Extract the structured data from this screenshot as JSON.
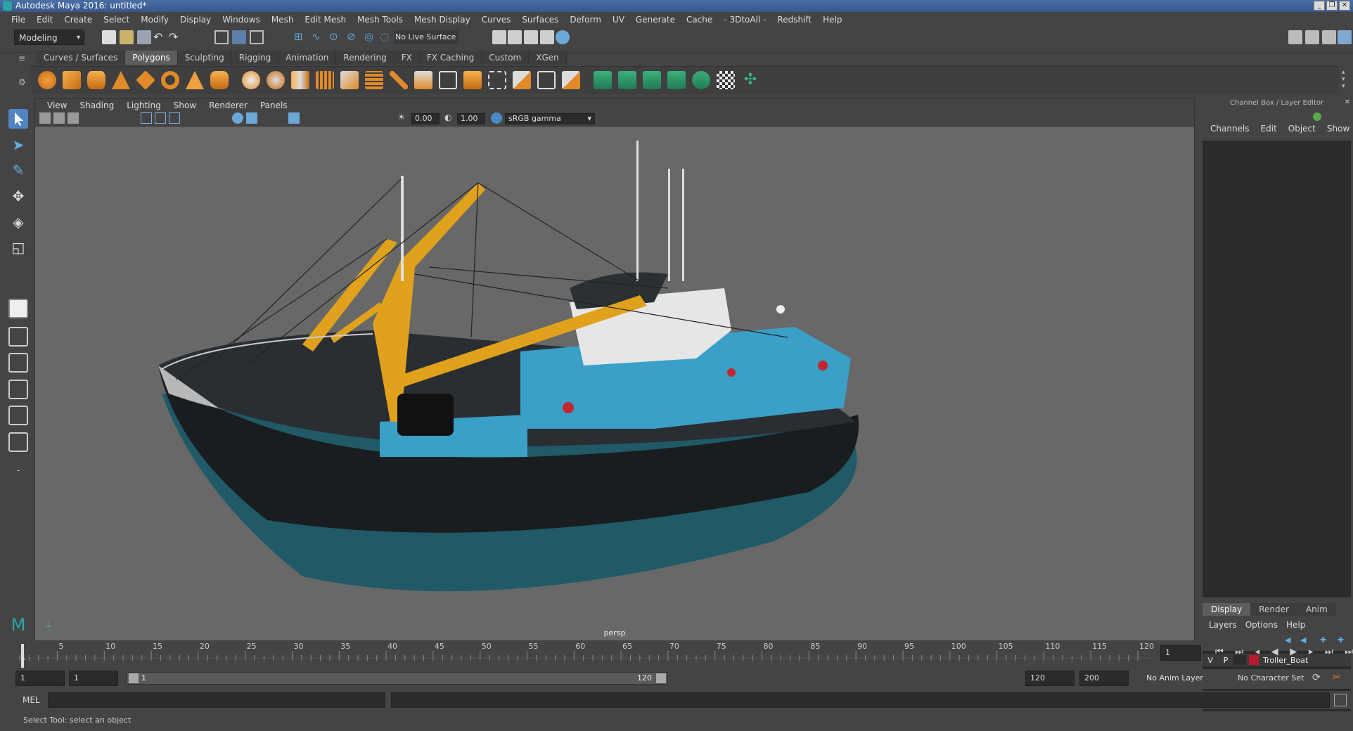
{
  "window": {
    "title": "Autodesk Maya 2016: untitled*",
    "buttons": [
      "_",
      "❐",
      "✕"
    ]
  },
  "menubar": [
    "File",
    "Edit",
    "Create",
    "Select",
    "Modify",
    "Display",
    "Windows",
    "Mesh",
    "Edit Mesh",
    "Mesh Tools",
    "Mesh Display",
    "Curves",
    "Surfaces",
    "Deform",
    "UV",
    "Generate",
    "Cache",
    "- 3DtoAll -",
    "Redshift",
    "Help"
  ],
  "status_line": {
    "mode": "Modeling",
    "live_surface": "No Live Surface"
  },
  "shelf": {
    "tabs": [
      "Curves / Surfaces",
      "Polygons",
      "Sculpting",
      "Rigging",
      "Animation",
      "Rendering",
      "FX",
      "FX Caching",
      "Custom",
      "XGen"
    ],
    "active_tab": "Polygons"
  },
  "viewport": {
    "menu": [
      "View",
      "Shading",
      "Lighting",
      "Show",
      "Renderer",
      "Panels"
    ],
    "exposure": "0.00",
    "gamma": "1.00",
    "color_space": "sRGB gamma",
    "camera_label": "persp"
  },
  "channel_box": {
    "title": "Channel Box / Layer Editor",
    "menu": [
      "Channels",
      "Edit",
      "Object",
      "Show"
    ],
    "layer_tabs": [
      "Display",
      "Render",
      "Anim"
    ],
    "active_layer_tab": "Display",
    "layer_menu": [
      "Layers",
      "Options",
      "Help"
    ],
    "layers": [
      {
        "v": "V",
        "p": "P",
        "name": "Troller_Boat",
        "color": "#b51a2e"
      }
    ]
  },
  "timeline": {
    "ticks": [
      "1",
      "5",
      "10",
      "15",
      "20",
      "25",
      "30",
      "35",
      "40",
      "45",
      "50",
      "55",
      "60",
      "65",
      "70",
      "75",
      "80",
      "85",
      "90",
      "95",
      "100",
      "105",
      "110",
      "115",
      "120"
    ],
    "current_frame": "1"
  },
  "range": {
    "start": "1",
    "playback_start": "1",
    "slider_start": "1",
    "slider_end": "120",
    "playback_end": "120",
    "end": "200",
    "anim_layer": "No Anim Layer",
    "character_set": "No Character Set"
  },
  "command_line": {
    "label": "MEL"
  },
  "help_line": "Select Tool: select an object",
  "colors": {
    "accent": "#5285c4",
    "hull_blue": "#3aa0c8",
    "boom": "#e0a21c"
  }
}
